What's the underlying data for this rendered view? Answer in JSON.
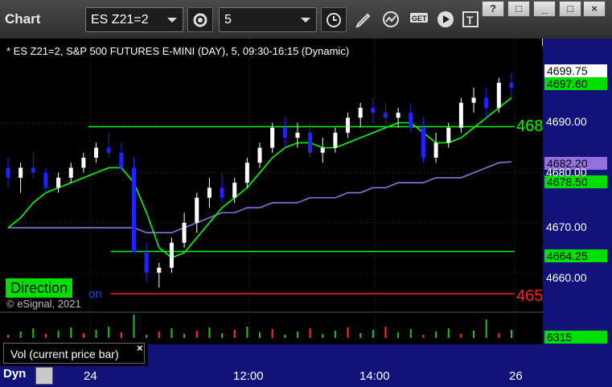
{
  "toolbar": {
    "title": "Chart",
    "symbol_value": "ES Z21=2",
    "interval_value": "5",
    "icons": [
      "settings-gear-icon",
      "clock-icon",
      "pencil-icon",
      "study-icon",
      "get-icon",
      "play-icon",
      "text-icon"
    ],
    "window_buttons": [
      "?",
      "□",
      "_",
      "□",
      "×"
    ]
  },
  "chart_header": "* ES Z21=2, S&P 500 FUTURES E-MINI (DAY), 5, 09:30-16:15 (Dynamic)",
  "watermark": "© eSignal, 2021",
  "direction_label": "Direction",
  "partial_label": "on",
  "green_level_label": "468",
  "red_level_label": "465",
  "volume_panel_label": "Vol (current price bar)",
  "volume_close": "×",
  "bottom": {
    "dyn_label": "Dyn"
  },
  "price_tags": [
    {
      "text": "4699.75",
      "bg": "#ffffff",
      "fg": "#000000"
    },
    {
      "text": "4697.60",
      "bg": "#00e000",
      "fg": "#000000"
    },
    {
      "text": "4682.20",
      "bg": "#9370db",
      "fg": "#000000"
    },
    {
      "text": "4678.50",
      "bg": "#00e000",
      "fg": "#000000"
    },
    {
      "text": "4664.25",
      "bg": "#00e000",
      "fg": "#000000"
    },
    {
      "text": "6315",
      "bg": "#00e000",
      "fg": "#000000"
    }
  ],
  "colors": {
    "up": "#ffffff",
    "down": "#2222ff",
    "ma_fast": "#00ff00",
    "ma_red": "#ff2020",
    "ma_purple": "#9370db",
    "level": "#00ff00"
  },
  "chart_data": {
    "type": "candlestick",
    "y_axis_ticks": [
      "4699.75",
      "4697.60",
      "4690.00",
      "4682.20",
      "4680.00",
      "4678.50",
      "4670.00",
      "4664.25",
      "4660.00"
    ],
    "x_axis_ticks": [
      "24",
      "12:00",
      "14:00",
      "26"
    ],
    "ylim": [
      4655,
      4702
    ],
    "levels": [
      {
        "name": "upper-green",
        "value": 4689.2,
        "color": "#00ff00"
      },
      {
        "name": "lower-green",
        "value": 4664.25,
        "color": "#00ff00"
      },
      {
        "name": "red",
        "value": 4655.8,
        "color": "#ff2020"
      }
    ],
    "candles": [
      [
        4681,
        4683,
        4677,
        4679
      ],
      [
        4679,
        4682,
        4676,
        4681
      ],
      [
        4681,
        4684,
        4679,
        4680
      ],
      [
        4680,
        4681,
        4676,
        4677
      ],
      [
        4677,
        4680,
        4676,
        4679
      ],
      [
        4679,
        4682,
        4678,
        4681
      ],
      [
        4681,
        4684,
        4680,
        4683
      ],
      [
        4683,
        4686,
        4682,
        4685
      ],
      [
        4685,
        4688,
        4683,
        4684
      ],
      [
        4684,
        4686,
        4680,
        4681
      ],
      [
        4681,
        4683,
        4672,
        4664
      ],
      [
        4664,
        4666,
        4658,
        4660
      ],
      [
        4660,
        4662,
        4657,
        4661
      ],
      [
        4661,
        4667,
        4660,
        4666
      ],
      [
        4666,
        4672,
        4665,
        4670
      ],
      [
        4670,
        4676,
        4668,
        4675
      ],
      [
        4675,
        4679,
        4673,
        4677
      ],
      [
        4677,
        4680,
        4674,
        4675
      ],
      [
        4675,
        4679,
        4674,
        4678
      ],
      [
        4678,
        4683,
        4677,
        4682
      ],
      [
        4682,
        4686,
        4681,
        4685
      ],
      [
        4685,
        4690,
        4684,
        4689
      ],
      [
        4689,
        4691,
        4685,
        4687
      ],
      [
        4687,
        4690,
        4685,
        4688
      ],
      [
        4688,
        4690,
        4683,
        4684
      ],
      [
        4684,
        4687,
        4682,
        4685
      ],
      [
        4685,
        4689,
        4684,
        4688
      ],
      [
        4688,
        4692,
        4687,
        4691
      ],
      [
        4691,
        4694,
        4689,
        4693
      ],
      [
        4693,
        4695,
        4690,
        4692
      ],
      [
        4692,
        4694,
        4690,
        4691
      ],
      [
        4691,
        4693,
        4689,
        4692
      ],
      [
        4692,
        4694,
        4688,
        4689
      ],
      [
        4689,
        4691,
        4682,
        4683
      ],
      [
        4683,
        4688,
        4682,
        4686
      ],
      [
        4686,
        4690,
        4685,
        4689
      ],
      [
        4689,
        4695,
        4688,
        4694
      ],
      [
        4694,
        4697,
        4692,
        4695
      ],
      [
        4695,
        4697,
        4691,
        4693
      ],
      [
        4693,
        4699,
        4692,
        4698
      ],
      [
        4698,
        4700,
        4695,
        4697
      ]
    ],
    "ma_fast": [
      4669,
      4671,
      4674,
      4676,
      4677,
      4678,
      4679,
      4680,
      4681,
      4681,
      4678,
      4672,
      4665,
      4663,
      4664,
      4667,
      4670,
      4673,
      4675,
      4677,
      4680,
      4683,
      4685,
      4686,
      4686,
      4685,
      4685,
      4686,
      4687,
      4688,
      4689,
      4690,
      4690,
      4688,
      4686,
      4686,
      4687,
      4689,
      4691,
      4693,
      4695
    ],
    "ma_purple": [
      4669,
      4669,
      4669,
      4669,
      4669,
      4669,
      4669,
      4669,
      4669,
      4669,
      4669,
      4668,
      4668,
      4668,
      4669,
      4670,
      4671,
      4672,
      4672,
      4673,
      4673,
      4674,
      4674,
      4674,
      4675,
      4675,
      4675,
      4676,
      4676,
      4677,
      4677,
      4678,
      4678,
      4678,
      4679,
      4679,
      4679,
      4680,
      4681,
      4682,
      4682.2
    ]
  }
}
